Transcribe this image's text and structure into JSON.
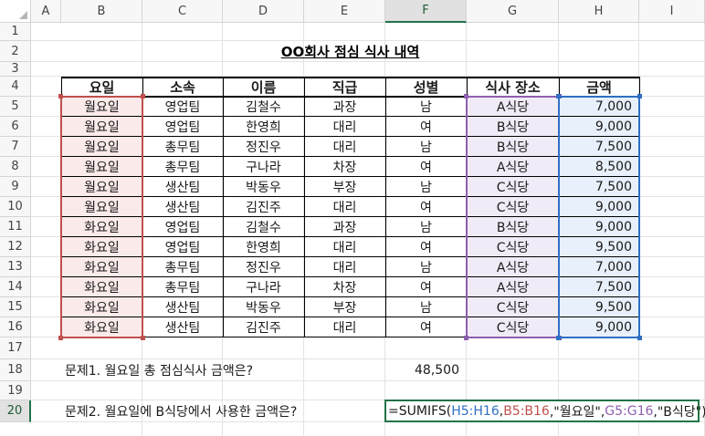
{
  "columns": [
    "A",
    "B",
    "C",
    "D",
    "E",
    "F",
    "G",
    "H",
    "I"
  ],
  "rows": [
    "1",
    "2",
    "3",
    "4",
    "5",
    "6",
    "7",
    "8",
    "9",
    "10",
    "11",
    "12",
    "13",
    "14",
    "15",
    "16",
    "17",
    "18",
    "19",
    "20"
  ],
  "title": "OO회사 점심 식사 내역",
  "headers": [
    "요일",
    "소속",
    "이름",
    "직급",
    "성별",
    "식사 장소",
    "금액"
  ],
  "table": [
    [
      "월요일",
      "영업팀",
      "김철수",
      "과장",
      "남",
      "A식당",
      "7,000"
    ],
    [
      "월요일",
      "영업팀",
      "한영희",
      "대리",
      "여",
      "B식당",
      "9,000"
    ],
    [
      "월요일",
      "총무팀",
      "정진우",
      "대리",
      "남",
      "B식당",
      "7,500"
    ],
    [
      "월요일",
      "총무팀",
      "구나라",
      "차장",
      "여",
      "A식당",
      "8,500"
    ],
    [
      "월요일",
      "생산팀",
      "박동우",
      "부장",
      "남",
      "C식당",
      "7,500"
    ],
    [
      "월요일",
      "생산팀",
      "김진주",
      "대리",
      "여",
      "C식당",
      "9,000"
    ],
    [
      "화요일",
      "영업팀",
      "김철수",
      "과장",
      "남",
      "B식당",
      "9,000"
    ],
    [
      "화요일",
      "영업팀",
      "한영희",
      "대리",
      "여",
      "C식당",
      "9,500"
    ],
    [
      "화요일",
      "총무팀",
      "정진우",
      "대리",
      "남",
      "A식당",
      "7,000"
    ],
    [
      "화요일",
      "총무팀",
      "구나라",
      "차장",
      "여",
      "A식당",
      "7,500"
    ],
    [
      "화요일",
      "생산팀",
      "박동우",
      "부장",
      "남",
      "C식당",
      "9,500"
    ],
    [
      "화요일",
      "생산팀",
      "김진주",
      "대리",
      "여",
      "C식당",
      "9,000"
    ]
  ],
  "q1": {
    "label": "문제1. 월요일 총 점심식사 금액은?",
    "answer": "48,500"
  },
  "q2": {
    "label": "문제2. 월요일에 B식당에서 사용한 금액은?",
    "formula": {
      "f1": "=SUMIFS(",
      "r1": "H5:H16",
      "s1": ",",
      "r2": "B5:B16",
      "s2": ",\"월요일\",",
      "r3": "G5:G16",
      "s3": ",\"B식당\")"
    }
  },
  "colors": {
    "grid": "#e3e3e3",
    "header_bg": "#f7f7f7",
    "selected_accent": "#217346",
    "range_blue": "#2f6fc4",
    "range_red": "#c0504d",
    "range_purple": "#8e5fb0",
    "fill_blue": "#e8f0fb",
    "fill_red": "#fbeaea",
    "fill_purple": "#f1ebf7"
  }
}
